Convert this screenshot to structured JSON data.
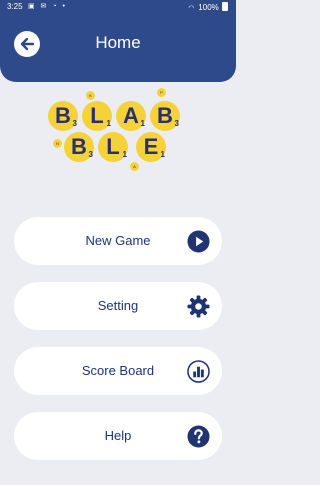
{
  "status_bar": {
    "time": "3:25",
    "icons": "▣ ✉ ◔ •",
    "wifi": "◜◝",
    "battery": "100%"
  },
  "header": {
    "title": "Home",
    "back_icon": "arrow-left-icon"
  },
  "logo": {
    "top_row": [
      {
        "letter": "B",
        "score": "3"
      },
      {
        "letter": "L",
        "score": "1"
      },
      {
        "letter": "A",
        "score": "1"
      },
      {
        "letter": "B",
        "score": "3"
      }
    ],
    "bottom_row": [
      {
        "letter": "B",
        "score": "3"
      },
      {
        "letter": "L",
        "score": "1"
      },
      {
        "letter": "E",
        "score": "1"
      }
    ],
    "small_tiles": [
      "K",
      "P",
      "N",
      "A"
    ]
  },
  "menu": {
    "new_game": {
      "label": "New Game",
      "icon": "play-icon"
    },
    "setting": {
      "label": "Setting",
      "icon": "gear-icon"
    },
    "score_board": {
      "label": "Score Board",
      "icon": "leaderboard-icon"
    },
    "help": {
      "label": "Help",
      "icon": "help-icon"
    }
  },
  "colors": {
    "header": "#2f4a8a",
    "accent": "#1f3470",
    "tile": "#f6d23a",
    "background": "#ebedf2"
  }
}
